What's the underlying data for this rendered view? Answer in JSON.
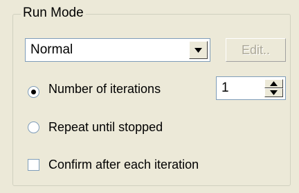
{
  "group": {
    "title": "Run Mode"
  },
  "mode_select": {
    "selected": "Normal",
    "arrow_icon": "chevron-down-icon"
  },
  "edit_button": {
    "label": "Edit..",
    "enabled": false
  },
  "options": {
    "iterations": {
      "label": "Number of iterations",
      "checked": true,
      "value": "1"
    },
    "repeat": {
      "label": "Repeat until stopped",
      "checked": false
    },
    "confirm": {
      "label": "Confirm after each iteration",
      "checked": false
    }
  }
}
